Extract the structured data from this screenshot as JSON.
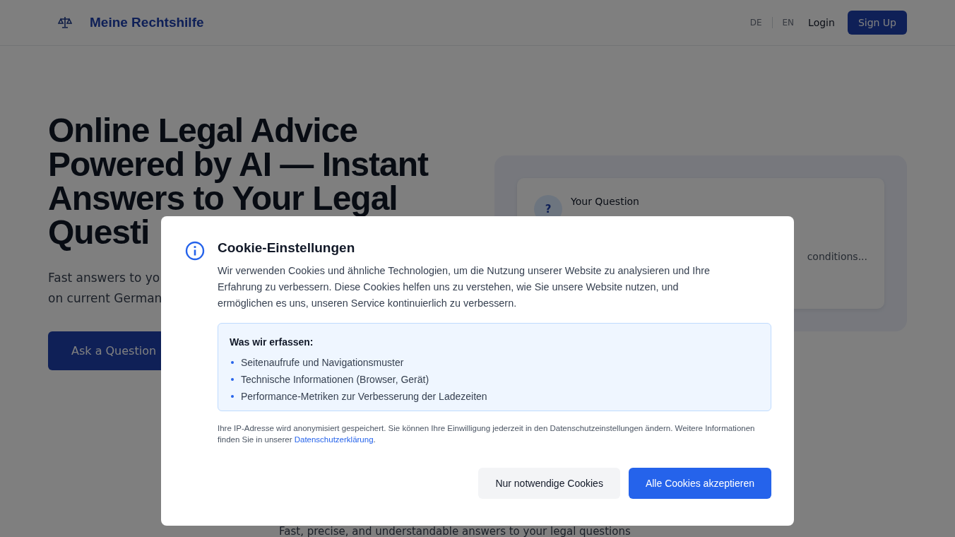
{
  "header": {
    "brand": "Meine Rechtshilfe",
    "languages": [
      {
        "label": "DE",
        "selected": false
      },
      {
        "label": "EN",
        "selected": false
      }
    ],
    "login": "Login",
    "signup": "Sign Up"
  },
  "hero": {
    "title_lines": [
      "Online Legal Advice",
      "Powered by AI — Instant",
      "Answers to Your Legal",
      "Questi"
    ],
    "subtitle_lines": [
      "Fast answers to yo",
      "on current German"
    ],
    "cta": "Ask a Question"
  },
  "preview_card": {
    "badge": "?",
    "label": "Your Question",
    "fragment": "conditions..."
  },
  "section_subtitle": "Fast, precise, and understandable answers to your legal questions",
  "cookie_dialog": {
    "title": "Cookie-Einstellungen",
    "intro": "Wir verwenden Cookies und ähnliche Technologien, um die Nutzung unserer Website zu analysieren und Ihre Erfahrung zu verbessern. Diese Cookies helfen uns zu verstehen, wie Sie unsere Website nutzen, und ermöglichen es uns, unseren Service kontinuierlich zu verbessern.",
    "collect_title": "Was wir erfassen:",
    "collect_items": [
      "Seitenaufrufe und Navigationsmuster",
      "Technische Informationen (Browser, Gerät)",
      "Performance-Metriken zur Verbesserung der Ladezeiten"
    ],
    "note": "Ihre IP-Adresse wird anonymisiert gespeichert. Sie können Ihre Einwilligung jederzeit in den Datenschutzeinstellungen ändern. Weitere Informationen finden Sie in unserer",
    "note_link": "Datenschutzerklärung",
    "note_end": ".",
    "buttons": [
      {
        "label": "Nur notwendige Cookies",
        "kind": "secondary"
      },
      {
        "label": "Alle Cookies akzeptieren",
        "kind": "primary"
      }
    ]
  }
}
